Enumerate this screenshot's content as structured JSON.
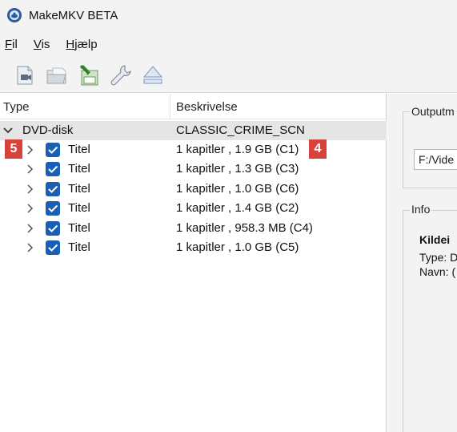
{
  "window": {
    "title": "MakeMKV BETA",
    "icon": "makemkv-app-icon"
  },
  "menu": {
    "items": [
      {
        "label": "Fil",
        "underline": "F",
        "rest": "il"
      },
      {
        "label": "Vis",
        "underline": "V",
        "rest": "is"
      },
      {
        "label": "Hjælp",
        "underline": "H",
        "rest": "jælp"
      }
    ]
  },
  "toolbar": {
    "buttons": [
      "open-disc-icon",
      "open-folder-icon",
      "save-to-mkv-icon",
      "settings-wrench-icon",
      "eject-icon"
    ]
  },
  "tree": {
    "columns": [
      "Type",
      "Beskrivelse"
    ],
    "root": {
      "type": "DVD-disk",
      "description": "CLASSIC_CRIME_SCN"
    },
    "titles": [
      {
        "type": "Titel",
        "description": "1 kapitler , 1.9 GB (C1)",
        "checked": true
      },
      {
        "type": "Titel",
        "description": "1 kapitler , 1.3 GB (C3)",
        "checked": true
      },
      {
        "type": "Titel",
        "description": "1 kapitler , 1.0 GB (C6)",
        "checked": true
      },
      {
        "type": "Titel",
        "description": "1 kapitler , 1.4 GB (C2)",
        "checked": true
      },
      {
        "type": "Titel",
        "description": "1 kapitler , 958.3 MB (C4)",
        "checked": true
      },
      {
        "type": "Titel",
        "description": "1 kapitler , 1.0 GB (C5)",
        "checked": true
      }
    ]
  },
  "annotations": {
    "badge_left": "5",
    "badge_right": "4",
    "badge_color": "#d9423a"
  },
  "right_panel": {
    "output_group_label": "Outputm",
    "output_path": "F:/Vide",
    "info_group_label": "Info",
    "info_lines": [
      "Kildei",
      "Type: D",
      "Navn: ("
    ]
  },
  "colors": {
    "checkbox": "#1a5fb4",
    "selected_row": "#e5e5e5",
    "chrome": "#f3f3f3"
  }
}
